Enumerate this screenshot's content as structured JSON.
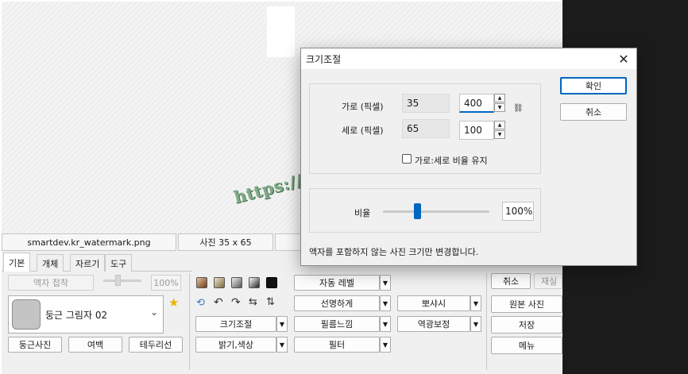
{
  "status": {
    "filename": "smartdev.kr_watermark.png",
    "size_text": "사진 35 x 65"
  },
  "tabs": [
    {
      "label": "기본"
    },
    {
      "label": "개체"
    },
    {
      "label": "자르기"
    },
    {
      "label": "도구"
    }
  ],
  "basic": {
    "frame_fold_label": "액자 접착",
    "percent_value": "100%",
    "frame_style_value": "둥근 그림자 02",
    "round_photo_label": "둥근사진",
    "margin_label": "여백",
    "border_label": "테두리선"
  },
  "tools": {
    "auto_level": "자동 레벨",
    "sharpen": "선명하게",
    "film_feel": "필름느낌",
    "filter": "필터",
    "resize": "크기조절",
    "brightness": "밝기,색상",
    "bbosyasi": "뽀샤시",
    "backlight": "역광보정"
  },
  "right": {
    "cancel": "취소",
    "redo": "재실",
    "original": "원본 사진",
    "save": "저장",
    "menu": "메뉴"
  },
  "dialog": {
    "title": "크기조절",
    "width_label": "가로 (픽셀)",
    "height_label": "세로 (픽셀)",
    "width_current": "35",
    "height_current": "65",
    "width_new": "400",
    "height_new": "100",
    "keep_ratio_label": "가로:세로 비율 유지",
    "keep_ratio_checked": false,
    "ratio_label": "비율",
    "ratio_value": "100%",
    "ratio_slider_fraction": 0.32,
    "ok": "확인",
    "cancel": "취소",
    "note": "액자를 포함하지 않는 사진 크기만 변경합니다."
  },
  "watermark_text": "https://smartdev.kr",
  "colors": {
    "accent": "#0067c0",
    "watermark": "#80aa88"
  }
}
